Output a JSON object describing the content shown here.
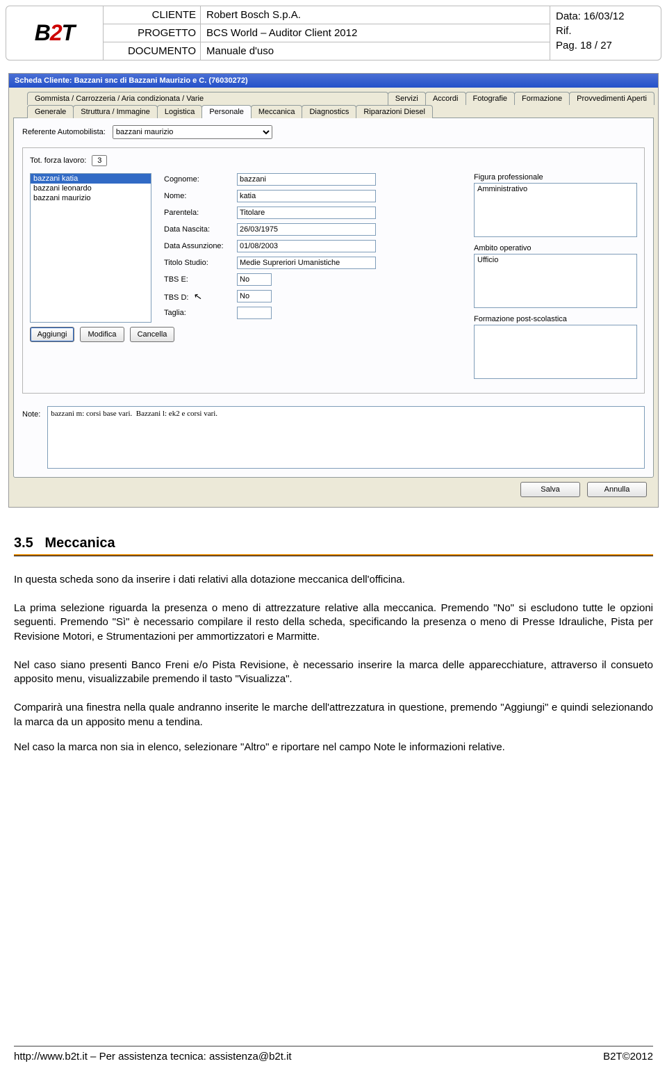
{
  "header": {
    "labels": {
      "cliente": "CLIENTE",
      "progetto": "PROGETTO",
      "documento": "DOCUMENTO"
    },
    "cliente": "Robert Bosch S.p.A.",
    "progetto": "BCS World – Auditor Client 2012",
    "documento": "Manuale d'uso",
    "data_label": "Data:",
    "data": "16/03/12",
    "rif_label": "Rif.",
    "pag_label": "Pag.",
    "pag": "18 / 27",
    "logo_b": "B",
    "logo_2": "2",
    "logo_t": "T"
  },
  "window": {
    "title": "Scheda Cliente: Bazzani snc di Bazzani Maurizio e C. (76030272)",
    "tabs_top": [
      "Gommista / Carrozzeria / Aria condizionata / Varie",
      "Servizi",
      "Accordi",
      "Fotografie",
      "Formazione",
      "Provvedimenti Aperti"
    ],
    "tabs_bottom": [
      "Generale",
      "Struttura / Immagine",
      "Logistica",
      "Personale",
      "Meccanica",
      "Diagnostics",
      "Riparazioni Diesel"
    ],
    "referente_label": "Referente Automobilista:",
    "referente_value": "bazzani maurizio",
    "forza_label": "Tot. forza lavoro:",
    "forza_value": "3",
    "list_items": [
      "bazzani katia",
      "bazzani leonardo",
      "bazzani maurizio"
    ],
    "form_labels": {
      "cognome": "Cognome:",
      "nome": "Nome:",
      "parentela": "Parentela:",
      "data_nascita": "Data Nascita:",
      "data_assunzione": "Data Assunzione:",
      "titolo_studio": "Titolo Studio:",
      "tbs_e": "TBS E:",
      "tbs_d": "TBS D:",
      "taglia": "Taglia:"
    },
    "form_values": {
      "cognome": "bazzani",
      "nome": "katia",
      "parentela": "Titolare",
      "data_nascita": "26/03/1975",
      "data_assunzione": "01/08/2003",
      "titolo_studio": "Medie Supreriori Umanistiche",
      "tbs_e": "No",
      "tbs_d": "No",
      "taglia": ""
    },
    "right": {
      "figura_label": "Figura professionale",
      "figura_value": "Amministrativo",
      "ambito_label": "Ambito operativo",
      "ambito_value": "Ufficio",
      "formazione_label": "Formazione post-scolastica",
      "formazione_value": ""
    },
    "buttons": {
      "aggiungi": "Aggiungi",
      "modifica": "Modifica",
      "cancella": "Cancella"
    },
    "note_label": "Note:",
    "note_value": "bazzani m: corsi base vari.  Bazzani l: ek2 e corsi vari.",
    "dlg_buttons": {
      "salva": "Salva",
      "annulla": "Annulla"
    }
  },
  "doc": {
    "heading_num": "3.5",
    "heading_text": "Meccanica",
    "p1": "In questa scheda sono da inserire i dati relativi alla dotazione meccanica dell'officina.",
    "p2": "La prima selezione riguarda la presenza o meno di attrezzature relative alla meccanica. Premendo \"No\" si escludono tutte le opzioni seguenti. Premendo \"Sì\" è necessario compilare il resto della scheda, specificando la presenza o meno di Presse Idrauliche, Pista per Revisione Motori, e Strumentazioni per ammortizzatori e Marmitte.",
    "p3": "Nel caso siano presenti Banco Freni e/o Pista Revisione, è necessario inserire la marca delle apparecchiature, attraverso il consueto apposito menu, visualizzabile premendo il tasto \"Visualizza\".",
    "p4": "Comparirà una finestra nella quale andranno inserite le marche dell'attrezzatura in questione, premendo \"Aggiungi\" e quindi selezionando la marca da un apposito menu a tendina.",
    "p5": "Nel caso la marca non sia in elenco, selezionare \"Altro\" e riportare nel campo Note le informazioni relative."
  },
  "footer": {
    "left_url": "http://www.b2t.it",
    "left_mid": " – Per assistenza tecnica: ",
    "left_email": "assistenza@b2t.it",
    "right": "B2T©2012"
  }
}
